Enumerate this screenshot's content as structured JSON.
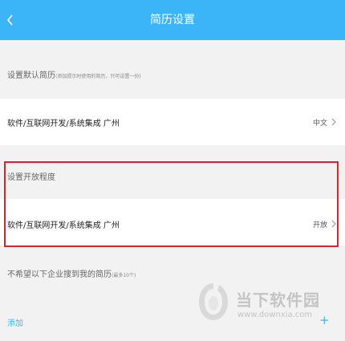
{
  "header": {
    "title": "简历设置",
    "back_icon": "chevron-left-icon"
  },
  "default_resume": {
    "label": "设置默认简历",
    "note": "(添加提示时使用的简历，只可设置一份)",
    "item_text": "软件/互联网开发/系统集成 广州",
    "item_value": "中文"
  },
  "openness": {
    "label": "设置开放程度",
    "item_text": "软件/互联网开发/系统集成 广州",
    "item_value": "开放"
  },
  "block_companies": {
    "label": "不希望以下企业搜到我的简历",
    "note": "(最多10个)",
    "add_label": "添加",
    "add_icon": "+"
  },
  "watermark": {
    "text": "当下软件园",
    "url": "www.downxia.com"
  },
  "colors": {
    "accent": "#3cb4f8",
    "highlight": "#e3202a",
    "background": "#f2f2f2"
  }
}
